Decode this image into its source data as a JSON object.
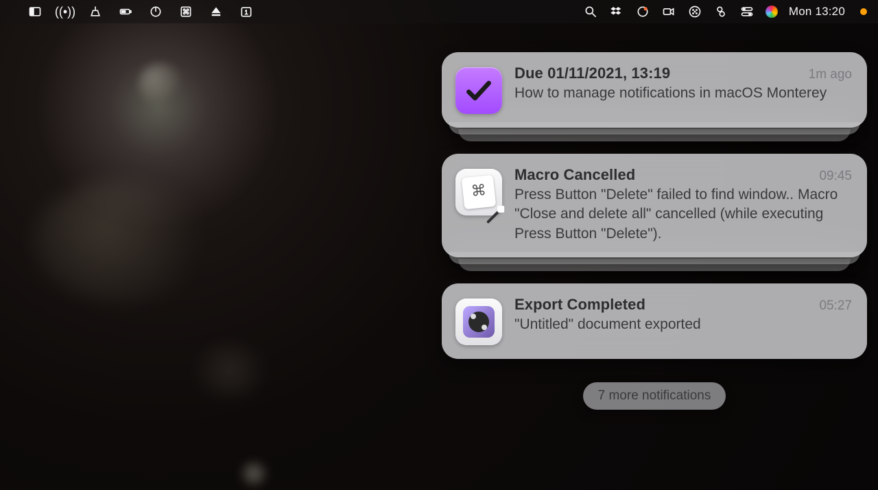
{
  "menubar": {
    "clock": "Mon 13:20"
  },
  "notifications": [
    {
      "title": "Due 01/11/2021, 13:19",
      "time": "1m ago",
      "body": "How to manage notifications in macOS Monterey"
    },
    {
      "title": "Macro Cancelled",
      "time": "09:45",
      "body": "Press Button \"Delete\" failed to find window.. Macro \"Close and delete all\" cancelled (while executing Press Button \"Delete\")."
    },
    {
      "title": "Export Completed",
      "time": "05:27",
      "body": "\"Untitled\" document exported"
    }
  ],
  "more": "7 more notifications"
}
